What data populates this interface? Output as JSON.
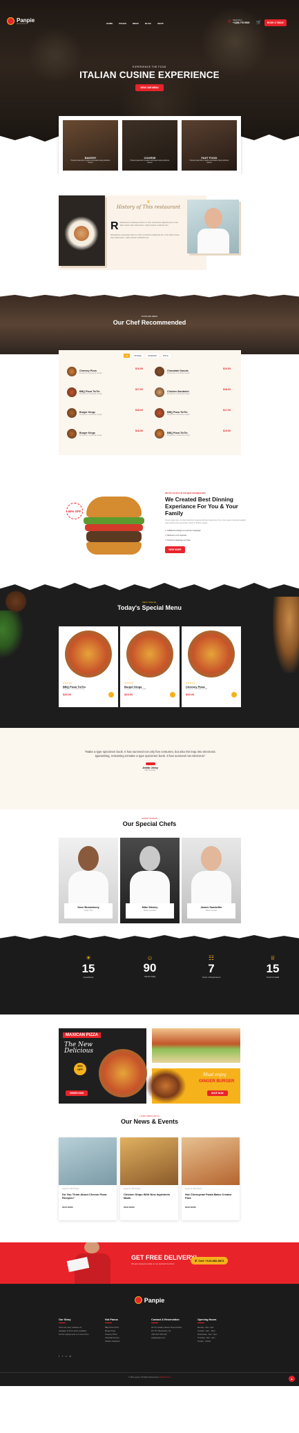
{
  "header": {
    "logo": "Panpie",
    "logo_tag": "DELICIOUS FOOD",
    "nav": [
      "HOME",
      "PAGES",
      "MENU",
      "BLOG",
      "SHOP"
    ],
    "need_help": "NEED HELP",
    "phone": "+1(88) 778 8526",
    "cta": "BOOK A TABLE"
  },
  "hero": {
    "kicker": "EXPERIENCE THE FOOD",
    "title": "ITALIAN CUSINE EXPERIENCE",
    "button": "VIEW OUR MENU"
  },
  "feature_cards": [
    {
      "title": "BAKERY",
      "text": "Popular pasta dish of pasta combination along delicious sauces"
    },
    {
      "title": "COURSE",
      "text": "Popular pasta dish of pasta combination along delicious sauces"
    },
    {
      "title": "FAST FOOD",
      "text": "Popular pasta dish of pasta combination along delicious sauces"
    }
  ],
  "history": {
    "script_title": "History of This restaurant",
    "dropcap": "R",
    "para1": "Restaurant's scelerisque dictum ut nihil, consectetur adipiscing elit. In iam abbu vestua ulam ullamcorper, mattis pulvinar vestibulum leo.",
    "para2": "Restaurant's scelerisque dictum ut nihil, consectetur adipiscing elit. In iam abbu vestua ulam ullamcorper, mattis pulvinar vestibulum leo."
  },
  "chef_rec": {
    "kicker": "FOOD AND MENU",
    "title": "Our Chef Recommended",
    "tabs": [
      "All",
      "Chicken",
      "Sandwich",
      "Pizza"
    ],
    "items": [
      {
        "name": "Cheesey Pizza",
        "desc": "Bruspinchu mozzarella vinegar",
        "price": "$16.50"
      },
      {
        "name": "Chocolate Donuts",
        "desc": "Bruspinchu mozzarella vinegar",
        "price": "$16.50"
      },
      {
        "name": "BBQ Pizza TinTin",
        "desc": "Bruspinchu mozzarella vinegar",
        "price": "$17.00"
      },
      {
        "name": "Chicken Sandwich",
        "desc": "Bruspinchu mozzarella vinegar",
        "price": "$18.00"
      },
      {
        "name": "Burger Kings",
        "desc": "Bruspinchu mozzarella vinegar",
        "price": "$18.00"
      },
      {
        "name": "BBQ Pizza TinTin",
        "desc": "Bruspinchu mozzarella vinegar",
        "price": "$17.00"
      },
      {
        "name": "Burger Kings",
        "desc": "Bruspinchu mozzarella vinegar",
        "price": "$18.50"
      },
      {
        "name": "BBQ Pizza TinTin",
        "desc": "Bruspinchu mozzarella vinegar",
        "price": "$19.50"
      }
    ]
  },
  "about": {
    "kicker": "WE TRY TO DO IT IN THE BEST POSSIBLE WAY",
    "title": "We Created Best Dinning Experiance For You & Your Family",
    "text": "Proven place item of what production spacious kitchen cleanness. On in vita means commodo sagittis quam tentur enim accumsan mauris in finibus magna.",
    "checks": [
      "Additional charge for premium toppings",
      "Minimum of 2 required",
      "Premium toppings not Free"
    ],
    "button": "VIEW MORE",
    "badge": "50% OFF"
  },
  "special": {
    "kicker": "MENU SPECIAL",
    "title": "Today's Special Menu",
    "items": [
      {
        "name": "BBQ Pizza TinTin",
        "desc": "Bruspinchu mozzarella vinegar",
        "price": "$30.00"
      },
      {
        "name": "Burger Kings",
        "desc": "Bruspinchu mozzarella vinegar",
        "price": "$25.00"
      },
      {
        "name": "Cheesey Pizza",
        "desc": "Bruspinchu mozzarella vinegar",
        "price": "$35.00"
      }
    ]
  },
  "testimonial": {
    "quote": "\"Make a type specimen book. It has survived not only five centuries, but also the leap into electronic typesetting, remaining esmake a type specimen book. It has survived not electronic\"",
    "name": "Jenifar Jenny",
    "role": "CEO Founder"
  },
  "chefs": {
    "kicker": "EXPERT WORKER",
    "title": "Our Special Chefs",
    "list": [
      {
        "name": "Sove Buskshemy",
        "role": "Pastry Chef"
      },
      {
        "name": "Mike Stickey",
        "role": "Master specialist"
      },
      {
        "name": "James Sandslifer",
        "role": "ASIAN manager"
      }
    ]
  },
  "stats": [
    {
      "num": "15",
      "label": "Ingredients"
    },
    {
      "num": "90",
      "label": "Clients Daily"
    },
    {
      "num": "7",
      "label": "Years of Experience"
    },
    {
      "num": "15",
      "label": "Fresh & Halal"
    }
  ],
  "promo": {
    "label": "MAXICAN PIZZA",
    "script": "The New Delicious",
    "discount": "35% OFF",
    "button1": "ORDER NOW",
    "burger_script": "Must enjoy",
    "burger_title": "GINGER BURGER",
    "button2": "SHOP NOW"
  },
  "news": {
    "kicker": "LATEST NEWS & BLOG",
    "title": "Our News & Events",
    "posts": [
      {
        "date": "August 12, 2021",
        "author": "Panpie",
        "title": "Do You Think About Cheese Pizza Recipes?",
        "more": "READ MORE"
      },
      {
        "date": "August 12, 2021",
        "author": "Panpie",
        "title": "Chicken Ships With New Ingridents Made.",
        "more": "READ MORE"
      },
      {
        "date": "August 12, 2021",
        "author": "Panpie",
        "title": "Hot Chessyraw Pasta Mako Creator Fact.",
        "more": "READ MORE"
      }
    ]
  },
  "delivery": {
    "title": "GET FREE DELIVERY!",
    "text": "We give awesome deals on our selected food item",
    "phone_btn": "Call: +123-866-8874"
  },
  "footer": {
    "logo": "Panpie",
    "cols": [
      {
        "title": "Our Story",
        "lines": [
          "There are many variations of",
          "passages of lorem ipsum available,",
          "but the majority have su in some form."
        ]
      },
      {
        "title": "Hot Panus",
        "lines": [
          "BBQ Pizza TinTin",
          "Burger Kings",
          "Cheesey Pizza",
          "Chocolate Donuts",
          "Chicken Sandwich"
        ]
      },
      {
        "title": "Contact & Reservation",
        "lines": [
          "46 Ocu Xeadey Hanzer Street Ambina",
          "DC 76 T Weewstonc, Ny",
          "+88 1234 7264 216",
          "info@panpie.com"
        ]
      },
      {
        "title": "Opening Hours",
        "lines": [
          "Monday : 9am - 6pm",
          "Tuesday : 9am - 10pm",
          "Wednesday : 9am - 9pm",
          "Thursday : 9am - 4pm",
          "Sunday : Closed"
        ]
      }
    ],
    "copyright": "© 2021 panpie. All Rights Reserved by",
    "copyright_brand": "RadiusTheme",
    "colors": {
      "accent": "#e8232a",
      "dark": "#1b1b1b",
      "cream": "#fbf6ee"
    }
  }
}
